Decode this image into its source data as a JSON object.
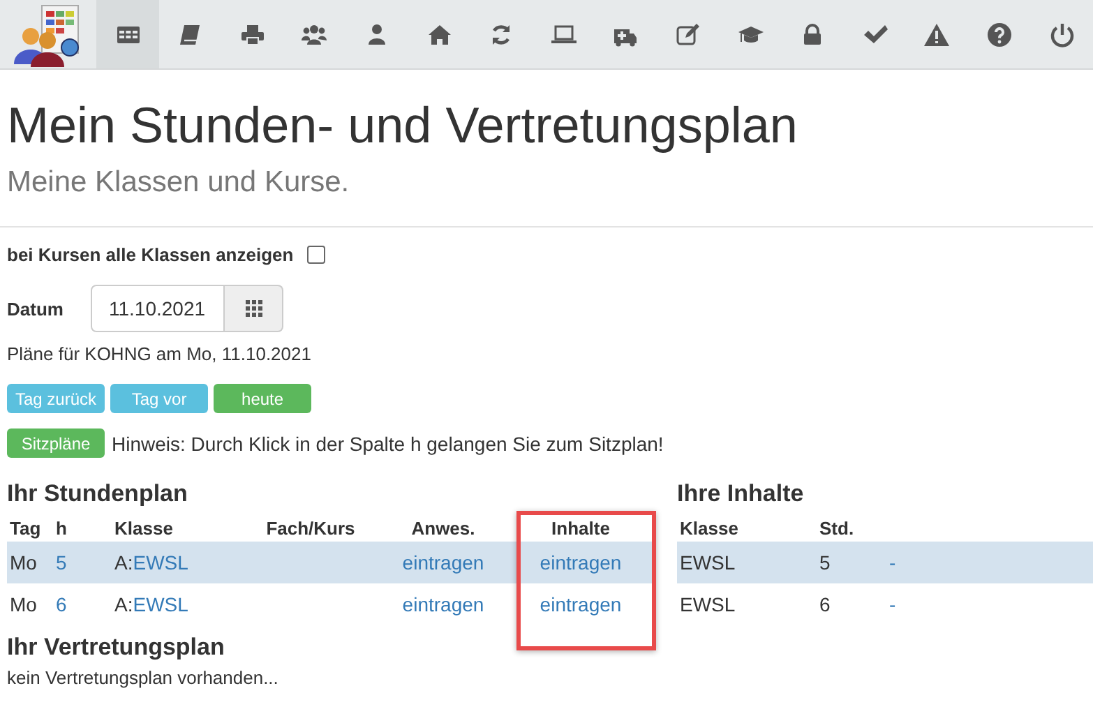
{
  "toolbar": [
    {
      "selected": true
    },
    {
      "selected": false
    },
    {
      "selected": false
    },
    {
      "selected": false
    },
    {
      "selected": false
    },
    {
      "selected": false
    },
    {
      "selected": false
    },
    {
      "selected": false
    },
    {
      "selected": false
    },
    {
      "selected": false
    },
    {
      "selected": false
    },
    {
      "selected": false
    },
    {
      "selected": false
    },
    {
      "selected": false
    },
    {
      "selected": false
    },
    {
      "selected": false
    }
  ],
  "title": "Mein Stunden- und Vertretungsplan",
  "subtitle": "Meine Klassen und Kurse.",
  "all_classes": {
    "label": "bei Kursen alle Klassen anzeigen",
    "checked": false
  },
  "date": {
    "label": "Datum",
    "value": "11.10.2021"
  },
  "plans_for": "Pläne für KOHNG am Mo, 11.10.2021",
  "nav_buttons": [
    {
      "label": "Tag zurück",
      "kind": "info"
    },
    {
      "label": "Tag vor",
      "kind": "info"
    },
    {
      "label": "heute",
      "kind": "success"
    }
  ],
  "seating": {
    "button": "Sitzpläne",
    "hint": "Hinweis: Durch Klick in der Spalte h gelangen Sie zum Sitzplan!"
  },
  "timetable": {
    "title": "Ihr Stundenplan",
    "columns": [
      {
        "label": "Tag",
        "highlighted": false
      },
      {
        "label": "h",
        "highlighted": false
      },
      {
        "label": "Klasse",
        "highlighted": false
      },
      {
        "label": "Fach/Kurs",
        "highlighted": false
      },
      {
        "label": "Anwes.",
        "highlighted": false
      },
      {
        "label": "Inhalte",
        "highlighted": true
      }
    ],
    "rows": [
      {
        "selected": true,
        "day": "Mo",
        "hour": "5",
        "class_prefix": "A:",
        "class_link": "EWSL",
        "attendance": "eintragen",
        "contents": "eintragen"
      },
      {
        "selected": false,
        "day": "Mo",
        "hour": "6",
        "class_prefix": "A:",
        "class_link": "EWSL",
        "attendance": "eintragen",
        "contents": "eintragen"
      }
    ]
  },
  "contents": {
    "title": "Ihre Inhalte",
    "columns": [
      "Klasse",
      "Std."
    ],
    "rows": [
      {
        "selected": true,
        "class": "EWSL",
        "hour": "5",
        "column_3": "-"
      },
      {
        "selected": false,
        "class": "EWSL",
        "hour": "6",
        "column_3": "-"
      }
    ]
  },
  "substitution": {
    "title": "Ihr Vertretungsplan",
    "text": "kein Vertretungsplan vorhanden..."
  }
}
